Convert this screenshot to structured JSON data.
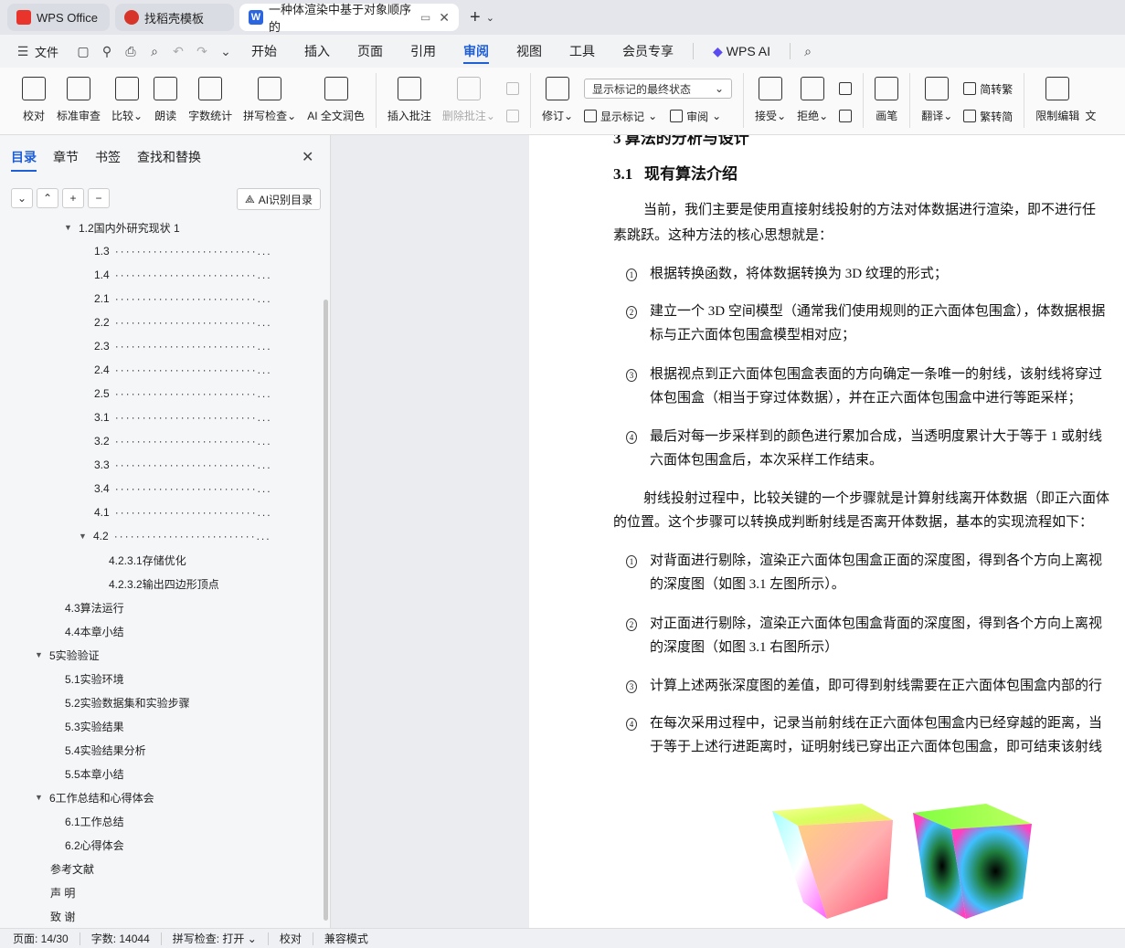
{
  "tabs": [
    {
      "label": "WPS Office"
    },
    {
      "label": "找稻壳模板"
    },
    {
      "label": "一种体渲染中基于对象顺序的"
    }
  ],
  "menu": {
    "file": "文件",
    "items": [
      "开始",
      "插入",
      "页面",
      "引用",
      "审阅",
      "视图",
      "工具",
      "会员专享"
    ],
    "active": "审阅",
    "wps_ai": "WPS AI"
  },
  "ribbon": {
    "proofread": "校对",
    "standard_review": "标准审查",
    "compare": "比较",
    "read_aloud": "朗读",
    "word_count": "字数统计",
    "spell_check": "拼写检查",
    "ai_polish": "AI 全文润色",
    "insert_comment": "插入批注",
    "delete_comment": "删除批注",
    "track_changes": "修订",
    "markup_select": "显示标记的最终状态",
    "show_markup": "显示标记",
    "review": "审阅",
    "accept": "接受",
    "reject": "拒绝",
    "pen": "画笔",
    "translate": "翻译",
    "to_traditional": "简转繁",
    "to_simplified": "繁转简",
    "restrict_edit": "限制编辑",
    "more": "文"
  },
  "nav": {
    "tabs": [
      "目录",
      "章节",
      "书签",
      "查找和替换"
    ],
    "ai_toc": "AI识别目录",
    "toc": [
      {
        "label": "1.2国内外研究现状 1",
        "level": 1,
        "arrow": "▼",
        "dots": false
      },
      {
        "label": "1.3",
        "level": 3,
        "dots": true
      },
      {
        "label": "1.4",
        "level": 3,
        "dots": true
      },
      {
        "label": "2.1",
        "level": 3,
        "dots": true
      },
      {
        "label": "2.2",
        "level": 3,
        "dots": true
      },
      {
        "label": "2.3",
        "level": 3,
        "dots": true
      },
      {
        "label": "2.4",
        "level": 3,
        "dots": true
      },
      {
        "label": "2.5",
        "level": 3,
        "dots": true
      },
      {
        "label": "3.1",
        "level": 3,
        "dots": true
      },
      {
        "label": "3.2",
        "level": 3,
        "dots": true
      },
      {
        "label": "3.3",
        "level": 3,
        "dots": true
      },
      {
        "label": "3.4",
        "level": 3,
        "dots": true
      },
      {
        "label": "4.1",
        "level": 3,
        "dots": true
      },
      {
        "label": "4.2",
        "level": 3,
        "arrow": "▼",
        "dots": true
      },
      {
        "label": "4.2.3.1存储优化",
        "level": 4,
        "dots": false
      },
      {
        "label": "4.2.3.2输出四边形顶点",
        "level": 4,
        "dots": false
      },
      {
        "label": "4.3算法运行",
        "level": 2,
        "dots": false
      },
      {
        "label": "4.4本章小结",
        "level": 2,
        "dots": false
      },
      {
        "label": "5实验验证",
        "level": 0,
        "arrow": "▼",
        "dots": false
      },
      {
        "label": "5.1实验环境",
        "level": 2,
        "dots": false
      },
      {
        "label": "5.2实验数据集和实验步骤",
        "level": 2,
        "dots": false
      },
      {
        "label": "5.3实验结果",
        "level": 2,
        "dots": false
      },
      {
        "label": "5.4实验结果分析",
        "level": 2,
        "dots": false
      },
      {
        "label": "5.5本章小结",
        "level": 2,
        "dots": false
      },
      {
        "label": "6工作总结和心得体会",
        "level": 0,
        "arrow": "▼",
        "dots": false
      },
      {
        "label": "6.1工作总结",
        "level": 2,
        "dots": false
      },
      {
        "label": "6.2心得体会",
        "level": 2,
        "dots": false
      },
      {
        "label": "参考文献",
        "level": 1,
        "dots": false
      },
      {
        "label": "声 明",
        "level": 1,
        "dots": false
      },
      {
        "label": "致 谢",
        "level": 1,
        "dots": false
      }
    ],
    "dots_text": "··························...",
    "ellipsis": "..."
  },
  "doc": {
    "cut_heading": "3 算法的分析与设计",
    "heading_num": "3.1",
    "heading": "现有算法介绍",
    "p1a": "当前，我们主要是使用直接射线投射的方法对体数据进行渲染，即不进行任",
    "p1b": "素跳跃。这种方法的核心思想就是：",
    "l1": "根据转换函数，将体数据转换为  3D 纹理的形式；",
    "l2a": "建立一个 3D 空间模型（通常我们使用规则的正六面体包围盒），体数据根据",
    "l2b": "标与正六面体包围盒模型相对应；",
    "l3a": "根据视点到正六面体包围盒表面的方向确定一条唯一的射线，该射线将穿过",
    "l3b": "体包围盒（相当于穿过体数据），并在正六面体包围盒中进行等距采样；",
    "l4a": "最后对每一步采样到的颜色进行累加合成，当透明度累计大于等于  1  或射线",
    "l4b": "六面体包围盒后，本次采样工作结束。",
    "p2a": "射线投射过程中，比较关键的一个步骤就是计算射线离开体数据（即正六面体",
    "p2b": "的位置。这个步骤可以转换成判断射线是否离开体数据，基本的实现流程如下：",
    "m1a": "对背面进行剔除，渲染正六面体包围盒正面的深度图，得到各个方向上离视",
    "m1b": "的深度图（如图 3.1 左图所示）。",
    "m2a": "对正面进行剔除，渲染正六面体包围盒背面的深度图，得到各个方向上离视",
    "m2b": "的深度图（如图 3.1 右图所示）",
    "m3a": "计算上述两张深度图的差值，即可得到射线需要在正六面体包围盒内部的行",
    "m4a": "在每次采用过程中，记录当前射线在正六面体包围盒内已经穿越的距离，当",
    "m4b": "于等于上述行进距离时，证明射线已穿出正六面体包围盒，即可结束该射线",
    "nums": [
      "1",
      "2",
      "3",
      "4"
    ]
  },
  "status": {
    "page": "页面: 14/30",
    "words": "字数: 14044",
    "spell": "拼写检查: 打开",
    "proof": "校对",
    "compat": "兼容模式"
  },
  "colors": {
    "accent": "#1e5fd6",
    "wps_red": "#e8342b",
    "docer_red": "#d8352a",
    "word_blue": "#2b65e0"
  }
}
